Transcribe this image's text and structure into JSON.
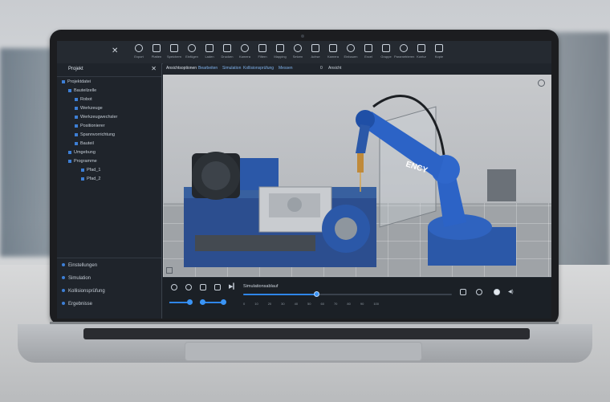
{
  "toolbar": {
    "close_label": "✕",
    "tools": [
      {
        "label": "Export"
      },
      {
        "label": "Platten"
      },
      {
        "label": "Speichern"
      },
      {
        "label": "Einfügen"
      },
      {
        "label": "Laden"
      },
      {
        "label": "Drucken"
      },
      {
        "label": "Kamera"
      },
      {
        "label": "Filtern"
      },
      {
        "label": "Mapping"
      },
      {
        "label": "Setzen"
      },
      {
        "label": "Achse"
      },
      {
        "label": "Kamera"
      },
      {
        "label": "Einbauen"
      },
      {
        "label": "Excel"
      },
      {
        "label": "Gruppe"
      },
      {
        "label": "Parametrieren"
      },
      {
        "label": "Kontur"
      },
      {
        "label": "Kopie"
      }
    ]
  },
  "sidebar": {
    "title": "Projekt",
    "close": "✕",
    "tree": [
      {
        "label": "Projektdatei",
        "indent": 0
      },
      {
        "label": "Bauteilzelle",
        "indent": 1
      },
      {
        "label": "Robot",
        "indent": 2
      },
      {
        "label": "Werkzeuge",
        "indent": 2
      },
      {
        "label": "Werkzeugwechsler",
        "indent": 2
      },
      {
        "label": "Positionierer",
        "indent": 2
      },
      {
        "label": "Spannvorrichtung",
        "indent": 2
      },
      {
        "label": "Bauteil",
        "indent": 2
      },
      {
        "label": "Umgebung",
        "indent": 1
      },
      {
        "label": "Programme",
        "indent": 1
      },
      {
        "label": "Pfad_1",
        "indent": 3
      },
      {
        "label": "Pfad_2",
        "indent": 3
      }
    ],
    "bottom_links": [
      "Einstellungen",
      "Simulation",
      "Kollisionsprüfung",
      "Ergebnisse"
    ]
  },
  "tabs": {
    "items": [
      "Ansichtsoptionen",
      "Bearbeiten",
      "Simulation",
      "Kollisionsprüfung",
      "Messen"
    ],
    "extra": [
      "0",
      "Ansicht"
    ]
  },
  "viewport": {
    "robot_brand": "ENCY"
  },
  "playback": {
    "title": "Simulationsablauf",
    "progress": 0.35,
    "ticks": [
      "0",
      "10",
      "20",
      "30",
      "40",
      "50",
      "60",
      "70",
      "80",
      "90",
      "100"
    ]
  }
}
